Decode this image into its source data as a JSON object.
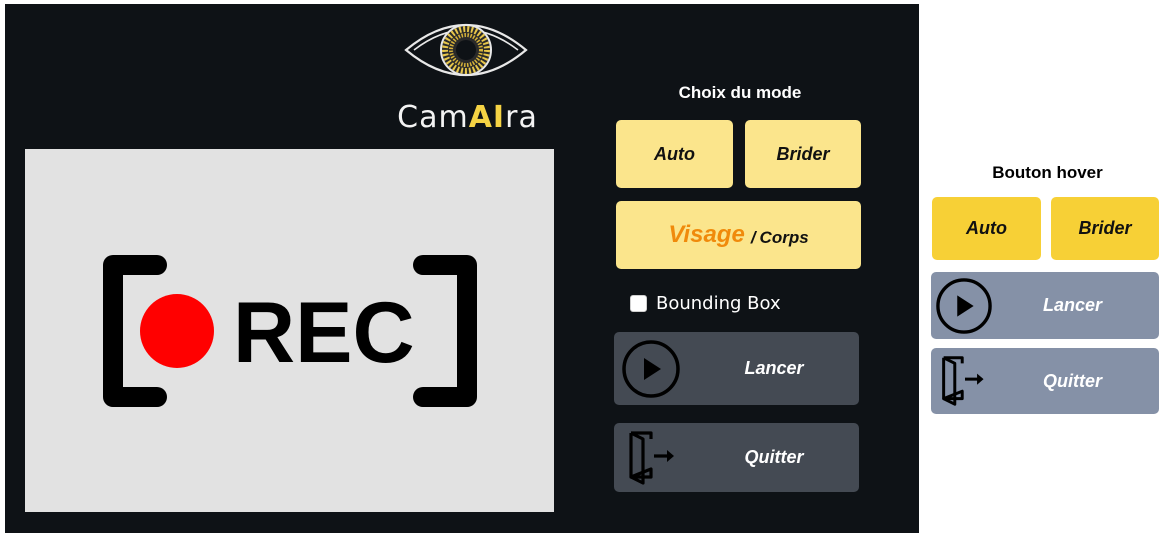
{
  "app": {
    "brand_prefix": "Cam",
    "brand_ai": "AI",
    "brand_suffix": "ra",
    "colors": {
      "background": "#0e1216",
      "accent": "#f5d344",
      "button_yellow": "#fbe58c",
      "button_yellow_hover": "#f7d036",
      "button_gray": "#444a53",
      "button_gray_hover": "#8591a7",
      "visage_orange": "#f08a0b"
    }
  },
  "preview": {
    "rec_text": "REC",
    "rec_dot_color": "#ff0000",
    "icon": "rec-icon"
  },
  "mode_panel": {
    "title": "Choix du mode",
    "auto_label": "Auto",
    "brider_label": "Brider",
    "visage_label": "Visage",
    "separator": "/",
    "corps_label": "Corps",
    "checkbox_label": "Bounding Box",
    "checkbox_checked": false,
    "launch_label": "Lancer",
    "launch_icon": "play-circle-icon",
    "quit_label": "Quitter",
    "quit_icon": "exit-door-icon"
  },
  "hover_demo": {
    "title": "Bouton hover",
    "auto_label": "Auto",
    "brider_label": "Brider",
    "launch_label": "Lancer",
    "quit_label": "Quitter"
  }
}
